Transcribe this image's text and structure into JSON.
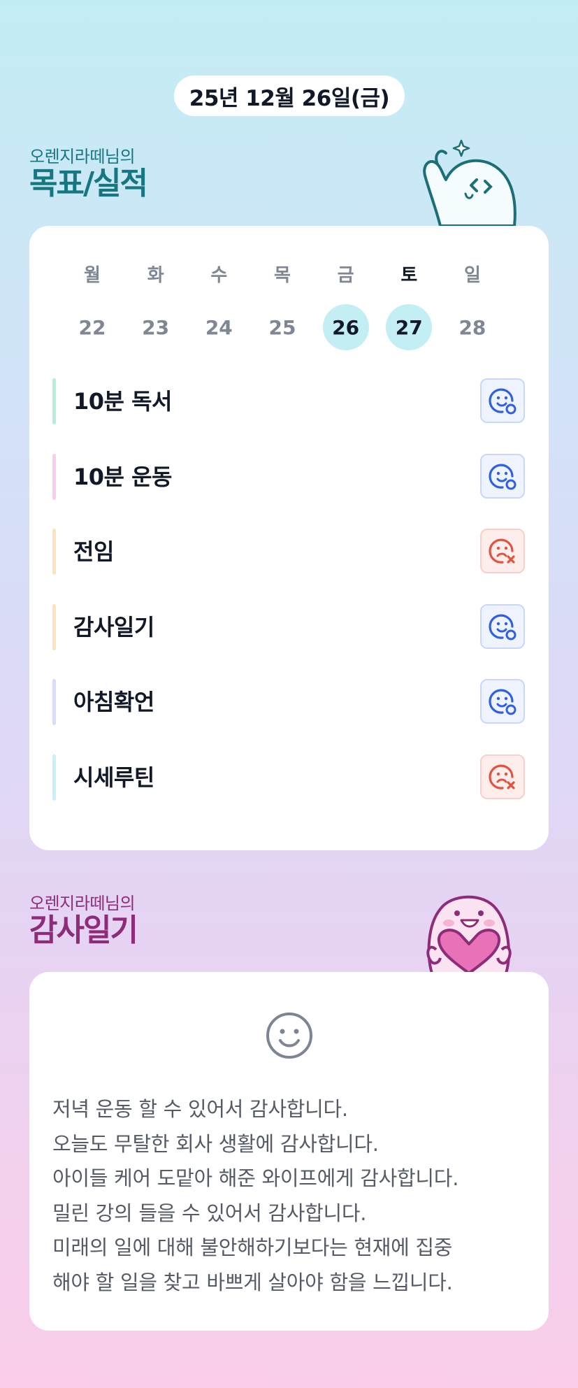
{
  "date_label": "25년 12월 26일(금)",
  "goal_section": {
    "subtitle": "오렌지라떼님의",
    "title": "목표/실적"
  },
  "calendar": {
    "day_names": [
      {
        "label": "월"
      },
      {
        "label": "화"
      },
      {
        "label": "수"
      },
      {
        "label": "목"
      },
      {
        "label": "금"
      },
      {
        "label": "토"
      },
      {
        "label": "일"
      }
    ],
    "dates": [
      {
        "label": "22"
      },
      {
        "label": "23"
      },
      {
        "label": "24"
      },
      {
        "label": "25"
      },
      {
        "label": "26"
      },
      {
        "label": "27"
      },
      {
        "label": "28"
      }
    ]
  },
  "goals": [
    {
      "label": "10분 독서",
      "color": "#b7eed8",
      "status": "done",
      "icon": "smile-check-icon"
    },
    {
      "label": "10분 운동",
      "color": "#f8cdea",
      "status": "done",
      "icon": "smile-check-icon"
    },
    {
      "label": "전임",
      "color": "#fbe3bd",
      "status": "fail",
      "icon": "sad-x-icon"
    },
    {
      "label": "감사일기",
      "color": "#fbe3bd",
      "status": "done",
      "icon": "smile-check-icon"
    },
    {
      "label": "아침확언",
      "color": "#d6defb",
      "status": "done",
      "icon": "smile-check-icon"
    },
    {
      "label": "시세루틴",
      "color": "#c9f1f4",
      "status": "fail",
      "icon": "sad-x-icon"
    }
  ],
  "gratitude_section": {
    "subtitle": "오렌지라떼님의",
    "title": "감사일기",
    "mood_icon": "smile-icon",
    "lines": [
      "저녁 운동 할 수 있어서 감사합니다.",
      "오늘도 무탈한 회사 생활에 감사합니다.",
      "아이들 케어 도맡아 해준 와이프에게 감사합니다.",
      "밀린 강의 들을 수 있어서 감사합니다.",
      "미래의 일에 대해 불안해하기보다는 현재에 집중",
      "해야 할 일을 찾고 바쁘게 살아야 함을 느낍니다."
    ]
  },
  "colors": {
    "done_icon": "#2f5fe3",
    "fail_icon": "#e2533f",
    "highlight_day": "#c3eef4",
    "goal_heading": "#167780",
    "gratitude_heading": "#8e2c79"
  }
}
